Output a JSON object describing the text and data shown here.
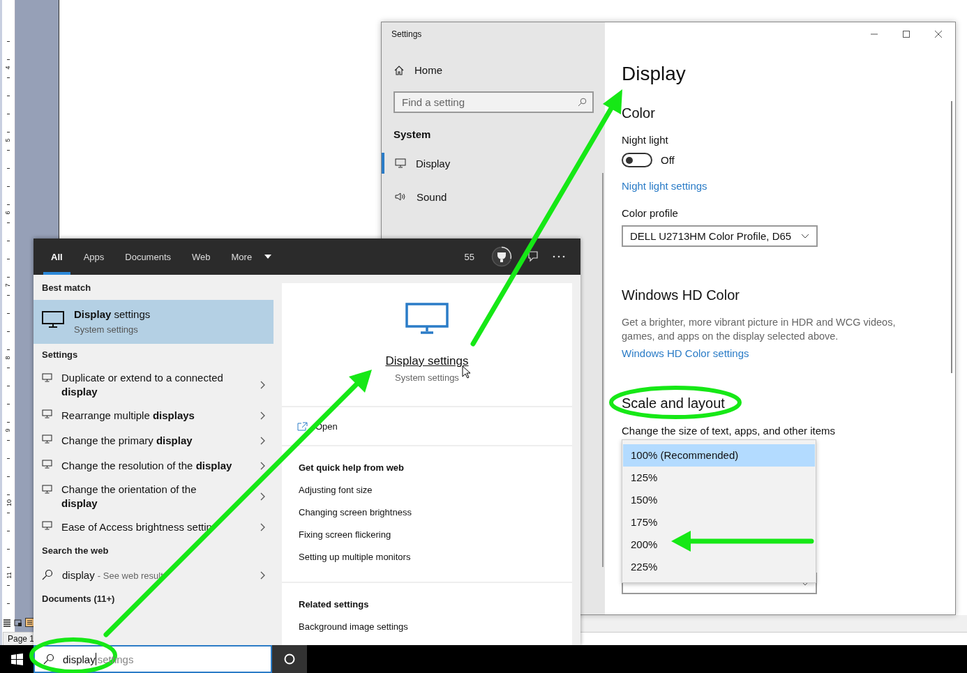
{
  "document": {
    "ruler_numbers": [
      "4",
      "5",
      "6",
      "7",
      "8",
      "9",
      "10",
      "11"
    ],
    "status": "Page 1"
  },
  "settings_window": {
    "title": "Settings",
    "sidebar": {
      "home": "Home",
      "search_placeholder": "Find a setting",
      "section": "System",
      "items": [
        {
          "label": "Display",
          "selected": true
        },
        {
          "label": "Sound",
          "selected": false
        }
      ]
    },
    "page": {
      "title": "Display",
      "color_heading": "Color",
      "night_light": {
        "label": "Night light",
        "on": false,
        "state_text": "Off"
      },
      "night_light_link": "Night light settings",
      "color_profile": {
        "label": "Color profile",
        "value": "DELL U2713HM Color Profile, D65"
      },
      "hd_heading": "Windows HD Color",
      "hd_text": "Get a brighter, more vibrant picture in HDR and WCG videos, games, and apps on the display selected above.",
      "hd_link": "Windows HD Color settings",
      "scale_heading": "Scale and layout",
      "scale_label": "Change the size of text, apps, and other items",
      "scale_options": [
        {
          "label": "100% (Recommended)",
          "selected": true
        },
        {
          "label": "125%",
          "selected": false
        },
        {
          "label": "150%",
          "selected": false
        },
        {
          "label": "175%",
          "selected": false
        },
        {
          "label": "200%",
          "selected": false
        },
        {
          "label": "225%",
          "selected": false
        }
      ]
    }
  },
  "search": {
    "tabs": [
      {
        "label": "All",
        "selected": true
      },
      {
        "label": "Apps",
        "selected": false
      },
      {
        "label": "Documents",
        "selected": false
      },
      {
        "label": "Web",
        "selected": false
      },
      {
        "label": "More",
        "selected": false
      }
    ],
    "points": "55",
    "best_match_heading": "Best match",
    "best_match": {
      "title": "**Display** settings",
      "subtitle": "System settings",
      "selected": true
    },
    "settings_heading": "Settings",
    "settings_results": [
      "Duplicate or extend to a connected **display**",
      "Rearrange multiple **displays**",
      "Change the primary **display**",
      "Change the resolution of the **display**",
      "Change the orientation of the **display**",
      "Ease of Access brightness settin"
    ],
    "web_heading": "Search the web",
    "web_result": {
      "query": "display",
      "hint": "- See web result"
    },
    "documents_heading": "Documents (11+)",
    "preview": {
      "title": "Display settings",
      "subtitle": "System settings",
      "open": "Open",
      "help_heading": "Get quick help from web",
      "help_links": [
        "Adjusting font size",
        "Changing screen brightness",
        "Fixing screen flickering",
        "Setting up multiple monitors"
      ],
      "related_heading": "Related settings",
      "related_links": [
        "Background image settings"
      ]
    }
  },
  "taskbar": {
    "search_value": "display",
    "search_suggestion": "settings"
  }
}
